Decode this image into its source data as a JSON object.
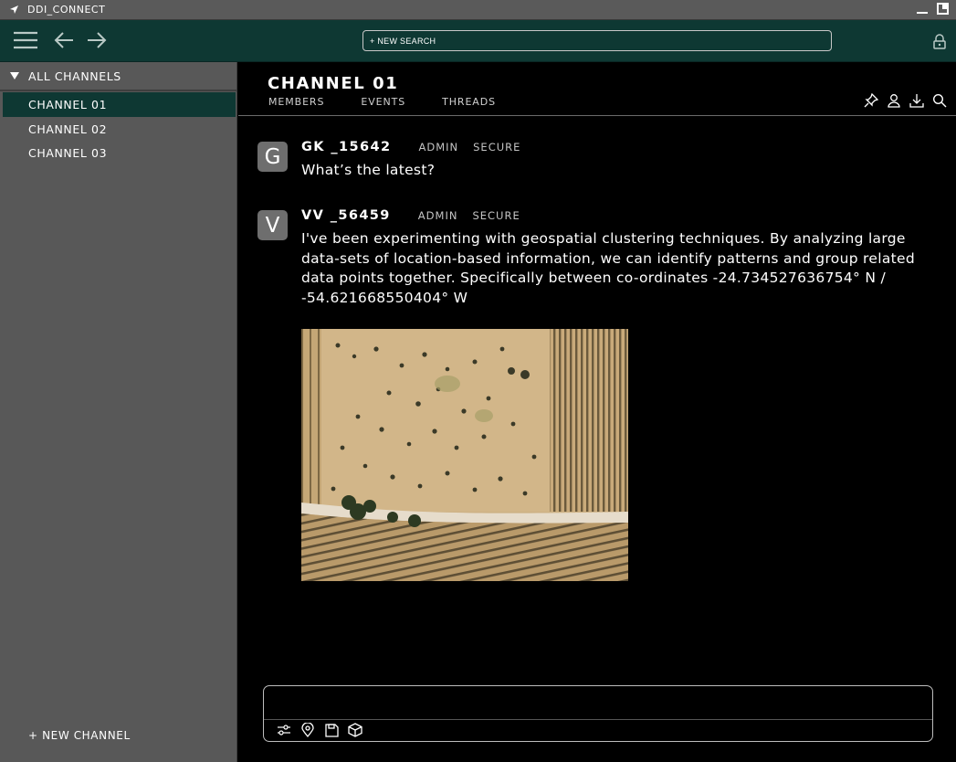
{
  "window": {
    "title": "DDI_CONNECT"
  },
  "toolbar": {
    "search_label": "+ NEW SEARCH",
    "icons": [
      "menu-icon",
      "back-arrow-icon",
      "forward-arrow-icon",
      "lock-icon"
    ]
  },
  "sidebar": {
    "header": "ALL CHANNELS",
    "items": [
      {
        "label": "CHANNEL 01",
        "active": true
      },
      {
        "label": "CHANNEL 02",
        "active": false
      },
      {
        "label": "CHANNEL 03",
        "active": false
      }
    ],
    "new_channel": "+ NEW CHANNEL"
  },
  "channel": {
    "title": "CHANNEL 01",
    "tabs": [
      "MEMBERS",
      "EVENTS",
      "THREADS"
    ],
    "actions": [
      "pin-icon",
      "user-icon",
      "download-icon",
      "search-icon"
    ]
  },
  "messages": [
    {
      "avatar": "G",
      "user": "GK _15642",
      "tags": [
        "ADMIN",
        "SECURE"
      ],
      "text": "What’s the latest?"
    },
    {
      "avatar": "V",
      "user": "VV _56459",
      "tags": [
        "ADMIN",
        "SECURE"
      ],
      "text": "I've been experimenting with geospatial clustering techniques. By analyzing large data-sets of location-based information, we can identify patterns and group related data points together. Specifically between co-ordinates -24.734527636754° N / -54.621668550404° W",
      "attachment": "aerial-farmland-image"
    }
  ],
  "composer": {
    "value": "",
    "tools": [
      "settings-sliders-icon",
      "location-pin-icon",
      "save-icon",
      "cube-icon"
    ]
  },
  "colors": {
    "toolbar_bg": "#0e3833",
    "sidebar_bg": "#585858",
    "active_item_bg": "#0e3833",
    "main_bg": "#000000"
  }
}
